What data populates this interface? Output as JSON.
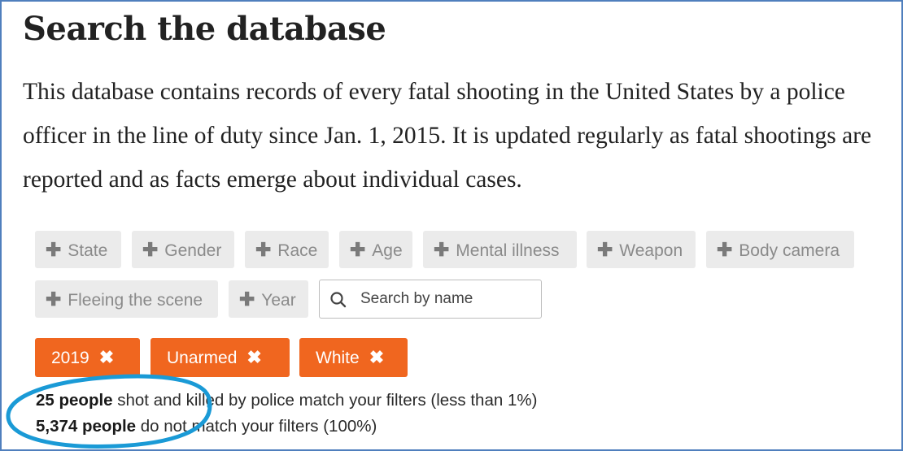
{
  "page": {
    "title": "Search the database",
    "intro": "This database contains records of every fatal shooting in the United States by a police officer in the line of duty since Jan. 1, 2015. It is updated regularly as fatal shootings are reported and as facts emerge about individual cases."
  },
  "filters": {
    "plus_glyph": "✚",
    "labels": [
      "State",
      "Gender",
      "Race",
      "Age",
      "Mental illness",
      "Weapon",
      "Body camera",
      "Fleeing the scene",
      "Year"
    ]
  },
  "search": {
    "placeholder": "Search by name"
  },
  "active_filters": {
    "remove_glyph": "✖",
    "tags": [
      "2019",
      "Unarmed",
      "White"
    ],
    "accent_color": "#f0661f"
  },
  "results": {
    "match_count": "25 people",
    "match_text": " shot and killed by police match your filters (less than 1%)",
    "nonmatch_count": "5,374 people",
    "nonmatch_text": " do not match your filters (100%)"
  },
  "annotation": {
    "oval_color": "#1a9ad6"
  }
}
